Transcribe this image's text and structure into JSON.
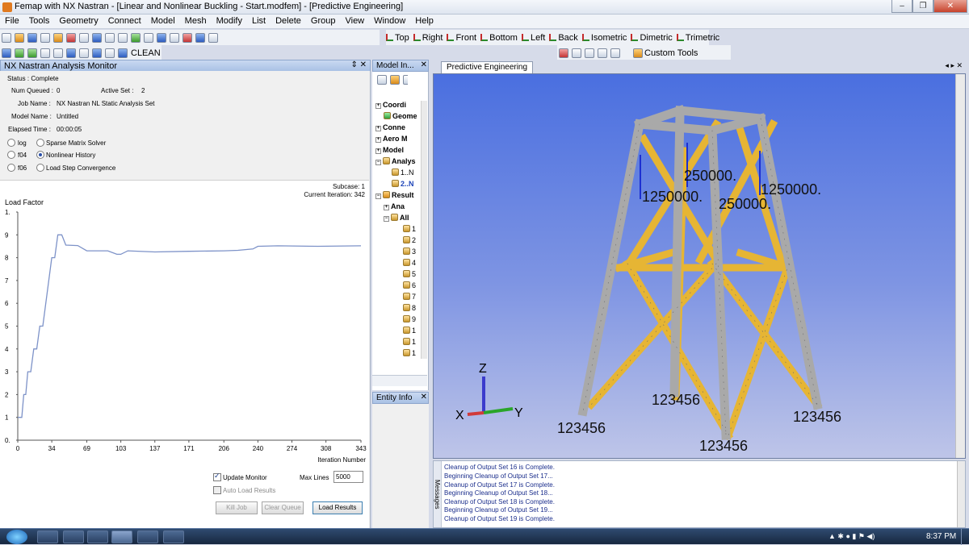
{
  "window": {
    "title": "Femap with NX Nastran - [Linear and Nonlinear Buckling - Start.modfem] - [Predictive Engineering]"
  },
  "menu": [
    "File",
    "Tools",
    "Geometry",
    "Connect",
    "Model",
    "Mesh",
    "Modify",
    "List",
    "Delete",
    "Group",
    "View",
    "Window",
    "Help"
  ],
  "toolbar": {
    "views": [
      "Top",
      "Right",
      "Front",
      "Bottom",
      "Left",
      "Back",
      "Isometric",
      "Dimetric",
      "Trimetric"
    ],
    "clean_label": "CLEAN",
    "custom_tools_label": "Custom Tools"
  },
  "monitor": {
    "title": "NX Nastran Analysis Monitor",
    "status": "Status : Complete",
    "num_queued_label": "Num Queued :",
    "num_queued": "0",
    "active_set_label": "Active Set :",
    "active_set": "2",
    "job_name_label": "Job Name :",
    "job_name": "NX Nastran NL Static Analysis Set",
    "model_name_label": "Model Name :",
    "model_name": "Untitled",
    "elapsed_label": "Elapsed Time :",
    "elapsed": "00:00:05",
    "radios": {
      "log": "log",
      "f04": "f04",
      "f06": "f06",
      "sparse": "Sparse Matrix Solver",
      "nonlinear": "Nonlinear History",
      "loadstep": "Load Step Convergence"
    },
    "subcase": "Subcase: 1",
    "iteration": "Current Iteration: 342",
    "update_monitor": "Update Monitor",
    "auto_load": "Auto Load Results",
    "max_lines_label": "Max Lines",
    "max_lines": "5000",
    "kill_job": "Kill Job",
    "clear_queue": "Clear Queue",
    "load_results": "Load Results"
  },
  "chart_data": {
    "type": "line",
    "ylabel": "Load Factor",
    "xlabel": "Iteration Number",
    "xlim": [
      0,
      343
    ],
    "ylim": [
      0,
      1
    ],
    "xticks": [
      "0",
      "34",
      "69",
      "103",
      "137",
      "171",
      "206",
      "240",
      "274",
      "308",
      "343"
    ],
    "yticks": [
      "0.",
      "1",
      "2",
      "3",
      "4",
      "5",
      "6",
      "7",
      "8",
      "9",
      "1."
    ],
    "x": [
      0,
      4,
      6,
      8,
      10,
      13,
      16,
      19,
      22,
      25,
      28,
      31,
      34,
      37,
      40,
      44,
      48,
      60,
      69,
      80,
      90,
      99,
      103,
      110,
      137,
      171,
      206,
      220,
      235,
      240,
      260,
      300,
      343
    ],
    "y": [
      0.1,
      0.1,
      0.2,
      0.2,
      0.3,
      0.3,
      0.4,
      0.4,
      0.5,
      0.5,
      0.6,
      0.7,
      0.8,
      0.8,
      0.9,
      0.9,
      0.855,
      0.853,
      0.83,
      0.83,
      0.83,
      0.815,
      0.815,
      0.83,
      0.825,
      0.828,
      0.83,
      0.832,
      0.838,
      0.85,
      0.852,
      0.85,
      0.852
    ]
  },
  "model_info": {
    "title": "Model In...",
    "items": [
      "Coordi",
      "Geome",
      "Conne",
      "Aero M",
      "Model",
      "Analys",
      "1..N",
      "2..N",
      "Result",
      "Ana",
      "All",
      "1",
      "2",
      "3",
      "4",
      "5",
      "6",
      "7",
      "8",
      "9",
      "1",
      "1",
      "1"
    ]
  },
  "entity_info": {
    "title": "Entity Info"
  },
  "viewport": {
    "tab": "Predictive Engineering",
    "load_labels": [
      "1250000.",
      "250000.",
      "1250000.",
      "250000."
    ],
    "constraint_labels": [
      "123456",
      "123456",
      "123456",
      "123456"
    ],
    "axes": {
      "x": "X",
      "y": "Y",
      "z": "Z"
    }
  },
  "messages": {
    "side_label": "Messages",
    "lines": [
      "Cleanup of Output Set 16 is Complete.",
      "Beginning Cleanup of Output Set 17...",
      "Cleanup of Output Set 17 is Complete.",
      "Beginning Cleanup of Output Set 18...",
      "Cleanup of Output Set 18 is Complete.",
      "Beginning Cleanup of Output Set 19...",
      "Cleanup of Output Set 19 is Complete."
    ]
  },
  "taskbar": {
    "clock": "8:37 PM"
  },
  "colors": {
    "viewport_top": "#4a6fe0",
    "member_yellow": "#e6b534",
    "member_gray": "#a9a9a9",
    "plot_line": "#7d92c8"
  }
}
